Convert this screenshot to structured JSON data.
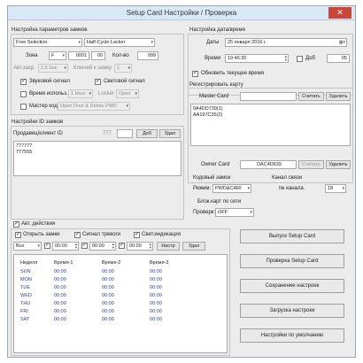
{
  "window": {
    "title": "Setup Card Настройки / Проверка",
    "close": "✕"
  },
  "lock_params": {
    "title": "Настройка параметров замков",
    "mode": "Free Selection",
    "cycle": "Half-Cycle Locker",
    "zone_label": "Зона",
    "zone_letter": "F",
    "zone_code": "0001",
    "zone_sub": "00",
    "count_label": "Кол-во",
    "count_value": "999",
    "autoclose_label": "Авт.закр.",
    "autoclose_value": "2.5 Sec",
    "key_label": "Ключей к замку",
    "key_value": "1",
    "sound_label": "Звуковой сигнал",
    "light_label": "Световой сигнал",
    "time_use_label": "Время использ.",
    "time_use_value": "1 Hour",
    "locker_label": "Locker",
    "locker_value": "Open",
    "master_code_label": "Мастер код",
    "master_code_value": "Open Door & Delete PWD"
  },
  "id_locks": {
    "title": "Настройки ID замков",
    "seller_label": "Продавец/клиент ID",
    "seller_value": "777",
    "add": "Доб",
    "del": "Удал",
    "items": [
      "777777",
      "777555"
    ]
  },
  "datetime": {
    "title": "Настройка дата/время",
    "date_label": "Даты",
    "date_value": "25  января  2016 г.",
    "time_label": "Время",
    "time_value": "19:46:30",
    "add": "Доб",
    "add_value": "05",
    "update_label": "Обновить текущее время"
  },
  "register": {
    "title": "Регистрировать карту",
    "master_label": "Master Card",
    "read": "Считать",
    "del": "Удалить",
    "items": [
      "0A4DD739(1)",
      "AA197C35(2)"
    ],
    "owner_label": "Owner Card",
    "owner_value": "DAC4D639",
    "owner_read": "Считать",
    "owner_del": "Удалить"
  },
  "code_lock": {
    "title": "Кодовый замок",
    "mode_label": "Режим:",
    "mode_value": "PWD&CARI"
  },
  "channel": {
    "title": "Канал связи",
    "num_label": "№ канала.",
    "num_value": "18"
  },
  "block": {
    "title": "Блок.карт по сети",
    "check_label": "Проверк:",
    "check_value": "OFF"
  },
  "auto_actions": {
    "title": "Авт. действия",
    "open_label": "Открыть замки",
    "alarm_label": "Сигнал тревоги",
    "light_label": "Свет.индикация",
    "period": "Все",
    "t1": "00:00",
    "t2": "00:00",
    "t3": "00:00",
    "setup": "Настр",
    "del": "Удал",
    "columns": [
      "Неделя",
      "Время-1",
      "Время-2",
      "Время-3"
    ],
    "rows": [
      [
        "SUN",
        "00:00",
        "00:00",
        "00:00"
      ],
      [
        "MON",
        "00:00",
        "00:00",
        "00:00"
      ],
      [
        "TUE",
        "00:00",
        "00:00",
        "00:00"
      ],
      [
        "WED",
        "00:00",
        "00:00",
        "00:00"
      ],
      [
        "THU",
        "00:00",
        "00:00",
        "00:00"
      ],
      [
        "FRI",
        "00:00",
        "00:00",
        "00:00"
      ],
      [
        "SAT",
        "00:00",
        "00:00",
        "00:00"
      ]
    ]
  },
  "actions": {
    "issue": "Выпуск Setup Card",
    "check": "Проверка Setup Card",
    "save": "Сохранение настроек",
    "load": "Загрузка настроек",
    "default": "Настройки по умолчанию"
  },
  "colors": {
    "title_bg": "#d9e8f7",
    "close_bg": "#c9463d",
    "table_text": "#2a3fa0",
    "window_bg": "#ececec"
  }
}
